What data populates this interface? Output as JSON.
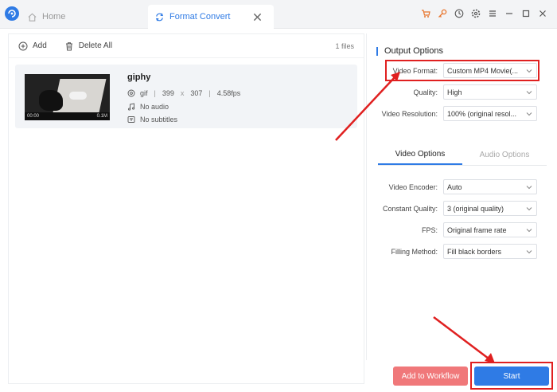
{
  "tabs": {
    "home": "Home",
    "convert": "Format Convert"
  },
  "toolbar": {
    "add": "Add",
    "delete_all": "Delete All",
    "files_count": "1 files"
  },
  "file": {
    "name": "giphy",
    "format": "gif",
    "width": "399",
    "times": "x",
    "height": "307",
    "fps": "4.58fps",
    "audio": "No audio",
    "subtitles": "No subtitles",
    "thumb_time": "00:00",
    "thumb_size": "0.1M"
  },
  "output_options": {
    "title": "Output Options",
    "video_format_label": "Video Format:",
    "video_format_value": "Custom MP4 Movie(...",
    "quality_label": "Quality:",
    "quality_value": "High",
    "resolution_label": "Video Resolution:",
    "resolution_value": "100% (original resol..."
  },
  "subtabs": {
    "video": "Video Options",
    "audio": "Audio Options"
  },
  "video_options": {
    "encoder_label": "Video Encoder:",
    "encoder_value": "Auto",
    "constant_quality_label": "Constant Quality:",
    "constant_quality_value": "3 (original quality)",
    "fps_label": "FPS:",
    "fps_value": "Original frame rate",
    "filling_label": "Filling Method:",
    "filling_value": "Fill black borders"
  },
  "buttons": {
    "add_to_workflow": "Add to Workflow",
    "start": "Start"
  },
  "colors": {
    "accent": "#2f7be5",
    "workflow": "#f0787a",
    "annotation": "#e02020"
  }
}
